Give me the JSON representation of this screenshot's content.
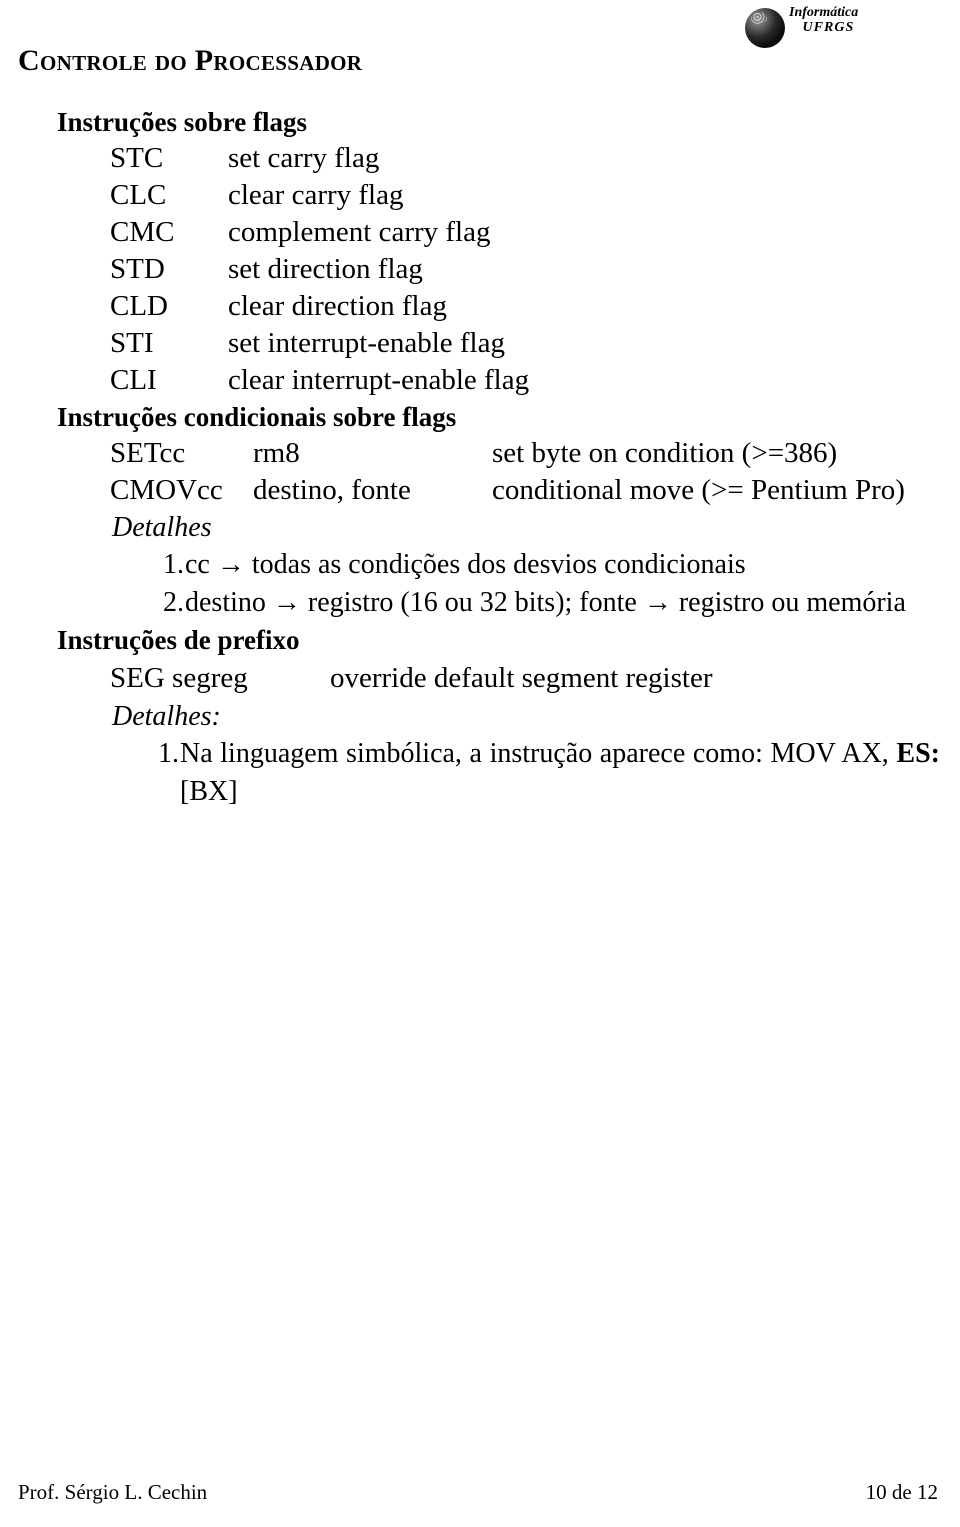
{
  "header": {
    "logo": {
      "name": "informatica-ufrgs-logo",
      "line1": "Informática",
      "line2": "UFRGS"
    }
  },
  "doc": {
    "title": "Controle do Processador"
  },
  "sections": [
    {
      "heading": "Instruções sobre flags",
      "rows": [
        {
          "mnemonic": "STC",
          "desc": "set carry flag"
        },
        {
          "mnemonic": "CLC",
          "desc": "clear carry flag"
        },
        {
          "mnemonic": "CMC",
          "desc": "complement carry flag"
        },
        {
          "mnemonic": "STD",
          "desc": "set direction flag"
        },
        {
          "mnemonic": "CLD",
          "desc": "clear direction flag"
        },
        {
          "mnemonic": "STI",
          "desc": "set interrupt-enable flag"
        },
        {
          "mnemonic": "CLI",
          "desc": "clear interrupt-enable flag"
        }
      ]
    },
    {
      "heading": "Instruções condicionais sobre flags",
      "rows": [
        {
          "mnemonic": "SETcc",
          "operand": "rm8",
          "desc": "set byte on condition (>=386)"
        },
        {
          "mnemonic": "CMOVcc",
          "operand": "destino, fonte",
          "desc": "conditional move (>= Pentium Pro)"
        }
      ],
      "details_label": "Detalhes",
      "details": [
        {
          "num": "1.",
          "text": "cc → todas as condições dos desvios condicionais"
        },
        {
          "num": "2.",
          "text": "destino → registro (16 ou 32 bits); fonte → registro ou memória"
        }
      ]
    },
    {
      "heading": "Instruções de prefixo",
      "seg": {
        "mnemonic": "SEG segreg",
        "desc": "override default segment register"
      },
      "details_label": "Detalhes:",
      "details": [
        {
          "num": "1.",
          "text_before": "Na linguagem simbólica, a instrução aparece como: MOV AX, ",
          "text_bold": "ES:",
          "text_after": "[BX]"
        }
      ]
    }
  ],
  "footer": {
    "author": "Prof. Sérgio L. Cechin",
    "page": "10 de 12"
  }
}
